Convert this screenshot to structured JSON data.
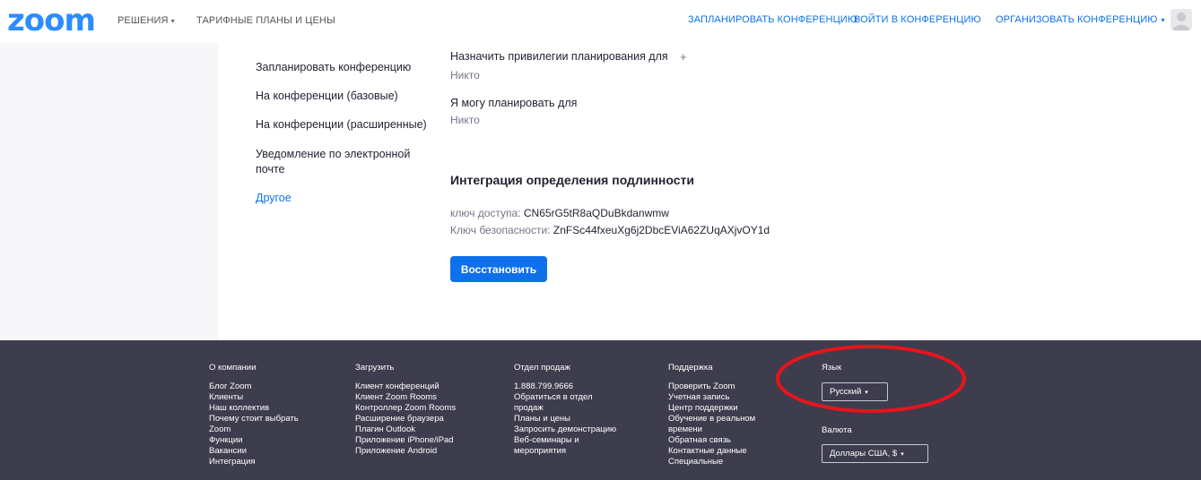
{
  "header": {
    "logo": "zoom",
    "nav_left": [
      "РЕШЕНИЯ",
      "ТАРИФНЫЕ ПЛАНЫ И ЦЕНЫ"
    ],
    "nav_left_caret": "▾",
    "nav_right": [
      "ЗАПЛАНИРОВАТЬ КОНФЕРЕНЦИЮ",
      "ВОЙТИ В КОНФЕРЕНЦИЮ",
      "ОРГАНИЗОВАТЬ КОНФЕРЕНЦИЮ"
    ],
    "nav_right_caret": "▾"
  },
  "sidebar": {
    "items": [
      {
        "label": "Запланировать конференцию"
      },
      {
        "label": "На конференции (базовые)"
      },
      {
        "label": "На конференции (расширенные)"
      },
      {
        "label": "Уведомление по электронной почте"
      },
      {
        "label": "Другое"
      }
    ],
    "active_index": 4
  },
  "content": {
    "assign_privileges_label": "Назначить привилегии планирования для",
    "assign_privileges_value": "Никто",
    "assign_plus": "+",
    "can_schedule_label": "Я могу планировать для",
    "can_schedule_value": "Никто",
    "auth_title": "Интеграция определения подлинности",
    "access_key_label": "ключ доступа:",
    "access_key_value": "CN65rG5tR8aQDuBkdanwmw",
    "security_key_label": "Ключ безопасности:",
    "security_key_value": "ZnFSc44fxeuXg6j2DbcEViA62ZUqAXjvOY1d",
    "restore_button": "Восстановить"
  },
  "footer": {
    "columns": [
      {
        "title": "О компании",
        "items": [
          "Блог Zoom",
          "Клиенты",
          "Наш коллектив",
          "Почему стоит выбрать",
          "Zoom",
          "Функции",
          "Вакансии",
          "Интеграция"
        ]
      },
      {
        "title": "Загрузить",
        "items": [
          "Клиент конференций",
          "Клиент Zoom Rooms",
          "Контроллер Zoom Rooms",
          "Расширение браузера",
          "Плагин Outlook",
          "Приложение iPhone/iPad",
          "Приложение Android"
        ]
      },
      {
        "title": "Отдел продаж",
        "items": [
          "1.888.799.9666",
          "Обратиться в отдел",
          "продаж",
          "Планы и цены",
          "Запросить демонстрацию",
          "Веб-семинары и",
          "мероприятия"
        ]
      },
      {
        "title": "Поддержка",
        "items": [
          "Проверить Zoom",
          "Учетная запись",
          "Центр поддержки",
          "Обучение в реальном",
          "времени",
          "Обратная связь",
          "Контактные данные",
          "Специальные"
        ]
      }
    ],
    "language_title": "Язык",
    "language_value": "Русский",
    "currency_title": "Валюта",
    "currency_value": "Доллары США, $",
    "caret": "▾"
  },
  "colors": {
    "brand": "#2d8cff",
    "link": "#0e71eb",
    "footer_bg": "#3d3d4e",
    "annotation": "#e8141c"
  }
}
